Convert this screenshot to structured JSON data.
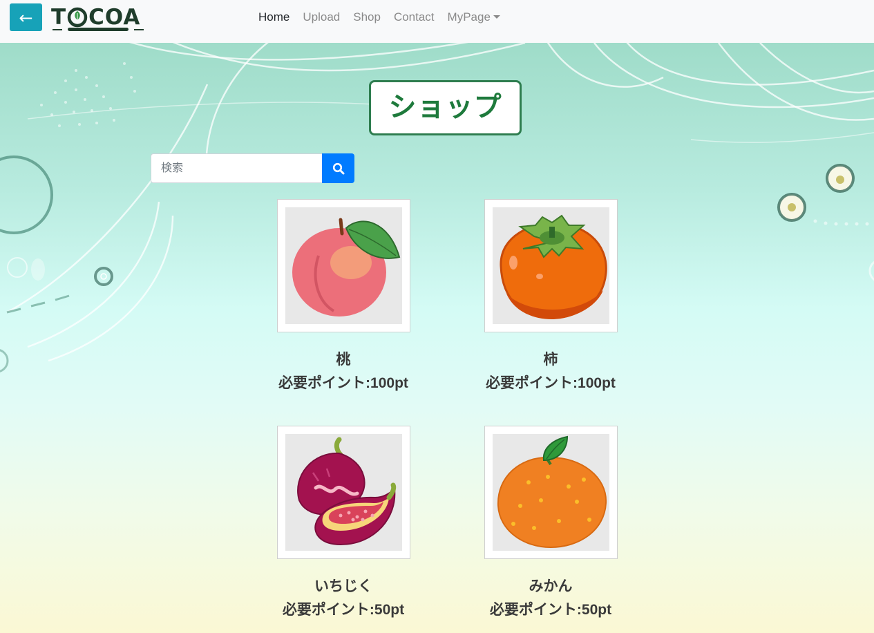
{
  "nav": {
    "back_label": "←",
    "brand": {
      "left": "T",
      "right": "COA"
    },
    "links": [
      {
        "label": "Home",
        "active": true
      },
      {
        "label": "Upload"
      },
      {
        "label": "Shop"
      },
      {
        "label": "Contact"
      },
      {
        "label": "MyPage",
        "dropdown": true
      }
    ]
  },
  "page": {
    "title": "ショップ"
  },
  "search": {
    "placeholder": "検索",
    "value": ""
  },
  "products": [
    {
      "name": "桃",
      "points": "必要ポイント:100pt",
      "icon": "peach-icon"
    },
    {
      "name": "柿",
      "points": "必要ポイント:100pt",
      "icon": "persimmon-icon"
    },
    {
      "name": "いちじく",
      "points": "必要ポイント:50pt",
      "icon": "fig-icon"
    },
    {
      "name": "みかん",
      "points": "必要ポイント:50pt",
      "icon": "mandarin-orange-icon"
    }
  ],
  "colors": {
    "accent_green": "#1e7a3c",
    "back_button": "#17a2b8",
    "search_button": "#007bff"
  }
}
